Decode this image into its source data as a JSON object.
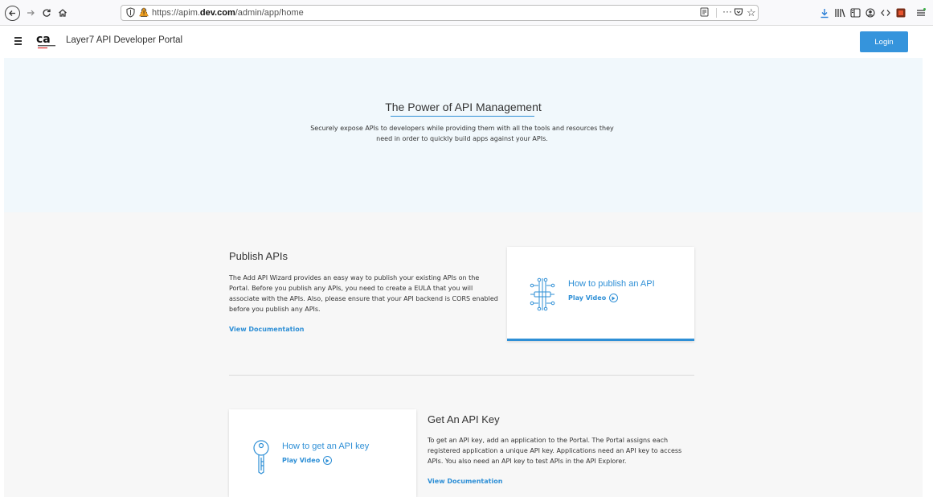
{
  "browser": {
    "url_prefix": "https://apim.",
    "url_domain": "dev.com",
    "url_path": "/admin/app/home",
    "more_label": "···"
  },
  "header": {
    "app_title": "Layer7 API Developer Portal",
    "login_label": "Login",
    "logo_text": "ca"
  },
  "hero": {
    "title": "The Power of API Management",
    "subtitle": "Securely expose APIs to developers while providing them with all the tools and resources they need in order to quickly build apps against your APIs."
  },
  "publish": {
    "heading": "Publish APIs",
    "description": "The Add API Wizard provides an easy way to publish your existing APIs on the Portal. Before you publish any APIs, you need to create a EULA that you will associate with the APIs. Also, please ensure that your API backend is CORS enabled before you publish any APIs.",
    "doc_link": "View Documentation",
    "card_title": "How to publish an API",
    "play_label": "Play Video"
  },
  "api_key": {
    "heading": "Get An API Key",
    "description": "To get an API key, add an application to the Portal. The Portal assigns each registered application a unique API key. Applications need an API key to access APIs. You also need an API key to test APIs in the API Explorer.",
    "doc_link": "View Documentation",
    "card_title": "How to get an API key",
    "play_label": "Play Video"
  },
  "colors": {
    "accent": "#2e8fd6",
    "login_bg": "#3594dc",
    "hero_bg": "#f1f8fc",
    "section_bg": "#f7f7f7"
  },
  "icons": [
    "back-icon",
    "forward-icon",
    "reload-icon",
    "home-icon",
    "shield-icon",
    "lock-icon",
    "reader-icon",
    "pocket-icon",
    "star-icon",
    "download-icon",
    "library-icon",
    "sidebar-icon",
    "account-icon",
    "devtools-icon",
    "extension-icon",
    "menu-icon",
    "hamburger-icon",
    "circuit-icon",
    "key-icon",
    "play-icon"
  ]
}
